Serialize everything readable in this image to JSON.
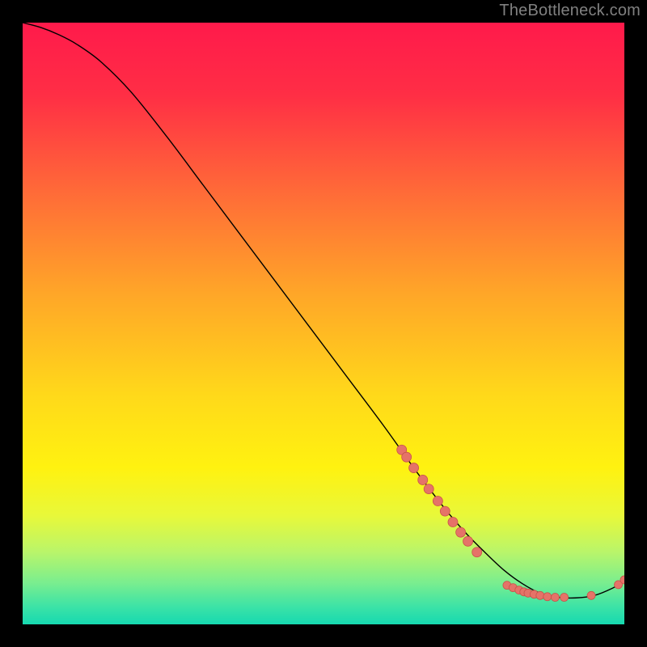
{
  "watermark": "TheBottleneck.com",
  "chart_data": {
    "type": "line",
    "title": "",
    "xlabel": "",
    "ylabel": "",
    "xlim": [
      0,
      100
    ],
    "ylim": [
      0,
      100
    ],
    "grid": false,
    "legend": false,
    "background_gradient": {
      "stops": [
        {
          "offset": 0.0,
          "color": "#ff1a4b"
        },
        {
          "offset": 0.12,
          "color": "#ff2e45"
        },
        {
          "offset": 0.28,
          "color": "#ff6a38"
        },
        {
          "offset": 0.45,
          "color": "#ffa628"
        },
        {
          "offset": 0.62,
          "color": "#ffd91a"
        },
        {
          "offset": 0.74,
          "color": "#fff210"
        },
        {
          "offset": 0.82,
          "color": "#e8f83a"
        },
        {
          "offset": 0.88,
          "color": "#b9f56a"
        },
        {
          "offset": 0.93,
          "color": "#7bee8e"
        },
        {
          "offset": 0.97,
          "color": "#3de3a6"
        },
        {
          "offset": 1.0,
          "color": "#16d9b0"
        }
      ]
    },
    "series": [
      {
        "name": "curve",
        "color": "#000000",
        "width": 1.4,
        "x": [
          0,
          3,
          6,
          9,
          13,
          18,
          24,
          30,
          36,
          42,
          48,
          54,
          60,
          65,
          68,
          71,
          74,
          77,
          80,
          83,
          86,
          89,
          92,
          95,
          98,
          100
        ],
        "y": [
          100,
          99.2,
          98.0,
          96.4,
          93.5,
          88.5,
          81.0,
          73.0,
          65.0,
          57.0,
          49.0,
          41.0,
          33.0,
          26.0,
          22.0,
          18.2,
          14.8,
          11.8,
          9.0,
          6.8,
          5.2,
          4.5,
          4.4,
          4.8,
          6.0,
          7.2
        ]
      }
    ],
    "markers": {
      "color": "#e57368",
      "stroke": "#c9524a",
      "radius_small": 5,
      "radius_large": 6,
      "points": [
        {
          "x": 63.0,
          "y": 29.0,
          "r": "large"
        },
        {
          "x": 63.8,
          "y": 27.8,
          "r": "large"
        },
        {
          "x": 65.0,
          "y": 26.0,
          "r": "large"
        },
        {
          "x": 66.5,
          "y": 24.0,
          "r": "large"
        },
        {
          "x": 67.5,
          "y": 22.5,
          "r": "large"
        },
        {
          "x": 69.0,
          "y": 20.5,
          "r": "large"
        },
        {
          "x": 70.2,
          "y": 18.8,
          "r": "large"
        },
        {
          "x": 71.5,
          "y": 17.0,
          "r": "large"
        },
        {
          "x": 72.8,
          "y": 15.3,
          "r": "large"
        },
        {
          "x": 74.0,
          "y": 13.8,
          "r": "large"
        },
        {
          "x": 75.5,
          "y": 12.0,
          "r": "large"
        },
        {
          "x": 80.5,
          "y": 6.5,
          "r": "small"
        },
        {
          "x": 81.5,
          "y": 6.1,
          "r": "small"
        },
        {
          "x": 82.5,
          "y": 5.7,
          "r": "small"
        },
        {
          "x": 83.3,
          "y": 5.4,
          "r": "small"
        },
        {
          "x": 84.0,
          "y": 5.2,
          "r": "small"
        },
        {
          "x": 85.0,
          "y": 5.0,
          "r": "small"
        },
        {
          "x": 86.0,
          "y": 4.8,
          "r": "small"
        },
        {
          "x": 87.2,
          "y": 4.6,
          "r": "small"
        },
        {
          "x": 88.5,
          "y": 4.5,
          "r": "small"
        },
        {
          "x": 90.0,
          "y": 4.5,
          "r": "small"
        },
        {
          "x": 94.5,
          "y": 4.8,
          "r": "small"
        },
        {
          "x": 99.0,
          "y": 6.6,
          "r": "small"
        },
        {
          "x": 100.0,
          "y": 7.4,
          "r": "small"
        }
      ]
    }
  }
}
